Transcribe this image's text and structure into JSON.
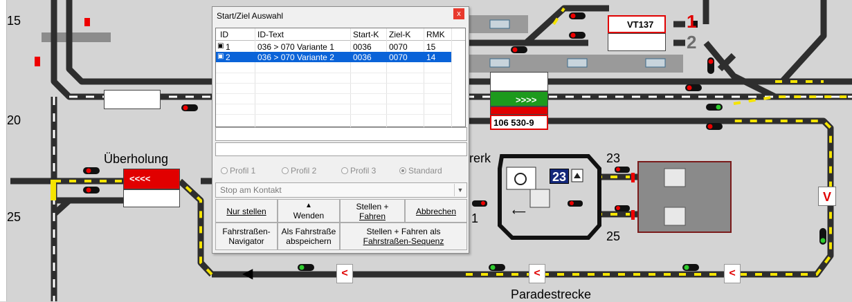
{
  "track_labels": {
    "row_15": "15",
    "row_20": "20",
    "row_25": "25",
    "ueberholung": "Überholung",
    "paradestrecke": "Paradestrecke",
    "werk_fragment": "rerk",
    "track_23": "23",
    "track_25": "25",
    "track_1_fragment": "1",
    "platform_1": "1",
    "platform_2": "2"
  },
  "train_boxes": {
    "vt137": "VT137",
    "arrows_right": ">>>>",
    "loco_number": "106 530-9",
    "arrows_left": "<<<<",
    "turntable_number": "23",
    "signal_v": "V",
    "marker_lt": "<"
  },
  "colors": {
    "background": "#d4d4d4",
    "track": "#333333",
    "track_highlight": "#f5e400",
    "occupied": "#e10000",
    "route_set": "#1d9a1d",
    "dialog_selection": "#0a63d8"
  },
  "dialog": {
    "title": "Start/Ziel Auswahl",
    "close_label": "x",
    "columns": [
      "ID",
      "ID-Text",
      "Start-K",
      "Ziel-K",
      "RMK"
    ],
    "rows": [
      {
        "id": "1",
        "text": "036 > 070 Variante 1",
        "start": "0036",
        "ziel": "0070",
        "rmk": "15",
        "selected": false
      },
      {
        "id": "2",
        "text": "036 > 070 Variante 2",
        "start": "0036",
        "ziel": "0070",
        "rmk": "14",
        "selected": true
      }
    ],
    "radios": {
      "profil1": "Profil 1",
      "profil2": "Profil 2",
      "profil3": "Profil 3",
      "standard": "Standard"
    },
    "stop_select": "Stop am Kontakt",
    "buttons": {
      "nur_stellen": "Nur stellen",
      "wenden": "Wenden",
      "stellen_fahren_1": "Stellen +",
      "stellen_fahren_2": "Fahren",
      "abbrechen": "Abbrechen",
      "navigator_1": "Fahrstraßen-",
      "navigator_2": "Navigator",
      "speichern_1": "Als Fahrstraße",
      "speichern_2": "abspeichern",
      "sequenz_1": "Stellen + Fahren als",
      "sequenz_2": "Fahrstraßen-Sequenz"
    }
  }
}
